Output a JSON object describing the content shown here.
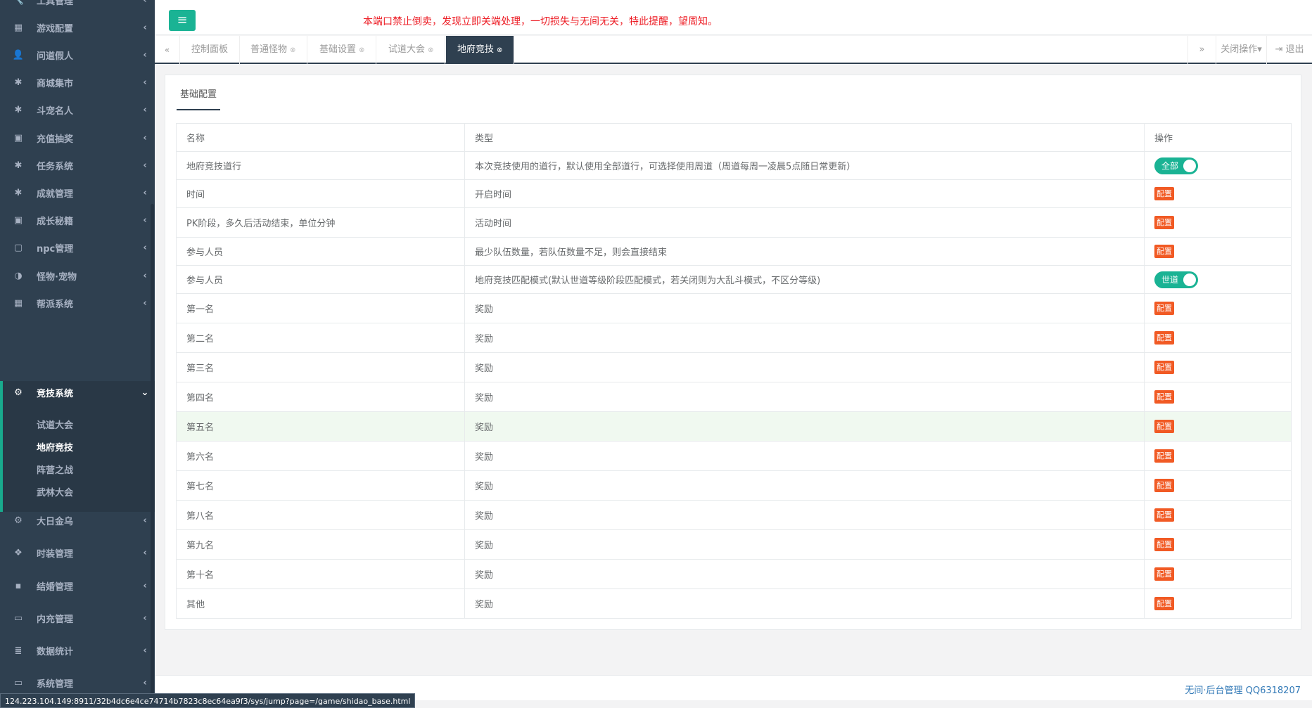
{
  "sidebar": {
    "items": [
      {
        "label": "工具管理",
        "icon": "wrench-icon",
        "glyph": "🔧"
      },
      {
        "label": "游戏配置",
        "icon": "table-icon",
        "glyph": "▦"
      },
      {
        "label": "问道假人",
        "icon": "user-icon",
        "glyph": "👤"
      },
      {
        "label": "商城集市",
        "icon": "gear-icon",
        "glyph": "✱"
      },
      {
        "label": "斗宠名人",
        "icon": "gear-icon",
        "glyph": "✱"
      },
      {
        "label": "充值抽奖",
        "icon": "money-icon",
        "glyph": "▣"
      },
      {
        "label": "任务系统",
        "icon": "gear-icon",
        "glyph": "✱"
      },
      {
        "label": "成就管理",
        "icon": "gear-icon",
        "glyph": "✱"
      },
      {
        "label": "成长秘籍",
        "icon": "money-icon",
        "glyph": "▣"
      },
      {
        "label": "npc管理",
        "icon": "square-icon",
        "glyph": "▢"
      },
      {
        "label": "怪物·宠物",
        "icon": "adjust-icon",
        "glyph": "◑"
      },
      {
        "label": "帮派系统",
        "icon": "table-icon",
        "glyph": "▦"
      }
    ],
    "active_group": {
      "label": "竞技系统",
      "icon": "cogs-icon",
      "glyph": "⚙",
      "children": [
        "试道大会",
        "地府竞技",
        "阵营之战",
        "武林大会"
      ]
    },
    "items_after": [
      {
        "label": "大日金乌",
        "icon": "cogs-icon",
        "glyph": "⚙"
      },
      {
        "label": "时装管理",
        "icon": "cubes-icon",
        "glyph": "❖"
      },
      {
        "label": "结婚管理",
        "icon": "book-icon",
        "glyph": "▪"
      },
      {
        "label": "内充管理",
        "icon": "monitor-icon",
        "glyph": "▭"
      },
      {
        "label": "数据统计",
        "icon": "database-icon",
        "glyph": "≣"
      },
      {
        "label": "系统管理",
        "icon": "monitor-icon",
        "glyph": "▭"
      }
    ],
    "arrow": "‹",
    "arrow_down": "⌄"
  },
  "topbar": {
    "menu_glyph": "≡",
    "notice": "本端口禁止倒卖，发现立即关端处理，一切损失与无间无关，特此提醒，望周知。"
  },
  "tabs": {
    "prev_glyph": "«",
    "next_glyph": "»",
    "close_glyph": "⊗",
    "items": [
      "控制面板",
      "普通怪物",
      "基础设置",
      "试道大会",
      "地府竞技"
    ],
    "active": "地府竞技",
    "close_ops": "关闭操作▾",
    "logout": "退出",
    "logout_glyph": "⇥"
  },
  "content": {
    "panel_tab": "基础配置",
    "headers": [
      "名称",
      "类型",
      "操作"
    ],
    "config_label": "配置",
    "rows": [
      {
        "name": "地府竞技道行",
        "type": "本次竞技使用的道行，默认使用全部道行，可选择使用周道（周道每周一凌晨5点随日常更新）",
        "action": "toggle",
        "toggle_label": "全部"
      },
      {
        "name": "时间",
        "type": "开启时间",
        "action": "config"
      },
      {
        "name": "PK阶段，多久后活动结束，单位分钟",
        "type": "活动时间",
        "action": "config"
      },
      {
        "name": "参与人员",
        "type": "最少队伍数量，若队伍数量不足，则会直接结束",
        "action": "config"
      },
      {
        "name": "参与人员",
        "type": "地府竞技匹配模式(默认世道等级阶段匹配模式，若关闭则为大乱斗模式，不区分等级)",
        "action": "toggle",
        "toggle_label": "世道"
      },
      {
        "name": "第一名",
        "type": "奖励",
        "action": "config"
      },
      {
        "name": "第二名",
        "type": "奖励",
        "action": "config"
      },
      {
        "name": "第三名",
        "type": "奖励",
        "action": "config"
      },
      {
        "name": "第四名",
        "type": "奖励",
        "action": "config"
      },
      {
        "name": "第五名",
        "type": "奖励",
        "action": "config",
        "highlight": true
      },
      {
        "name": "第六名",
        "type": "奖励",
        "action": "config"
      },
      {
        "name": "第七名",
        "type": "奖励",
        "action": "config"
      },
      {
        "name": "第八名",
        "type": "奖励",
        "action": "config"
      },
      {
        "name": "第九名",
        "type": "奖励",
        "action": "config"
      },
      {
        "name": "第十名",
        "type": "奖励",
        "action": "config"
      },
      {
        "name": "其他",
        "type": "奖励",
        "action": "config"
      }
    ]
  },
  "footer": {
    "text": "无间·后台管理 QQ6318207"
  },
  "statusbar": {
    "url": "124.223.104.149:8911/32b4dc6e4ce74714b7823c8ec64ea9f3/sys/jump?page=/game/shidao_base.html"
  }
}
